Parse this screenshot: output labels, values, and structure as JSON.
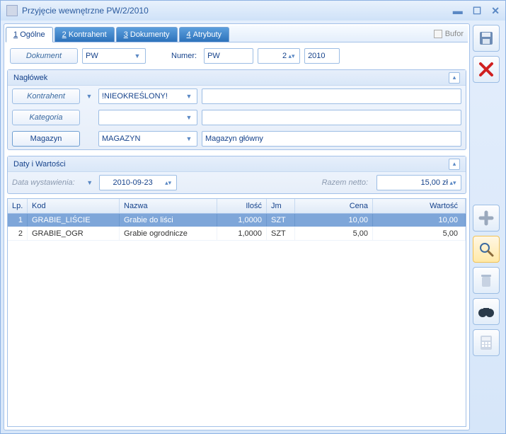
{
  "window": {
    "title": "Przyjęcie wewnętrzne PW/2/2010"
  },
  "tabs": [
    {
      "n": "1",
      "label": "Ogólne"
    },
    {
      "n": "2",
      "label": "Kontrahent"
    },
    {
      "n": "3",
      "label": "Dokumenty"
    },
    {
      "n": "4",
      "label": "Atrybuty"
    }
  ],
  "bufor_label": "Bufor",
  "docrow": {
    "doc_btn": "Dokument",
    "doc_type": "PW",
    "numer_label": "Numer:",
    "numer_prefix": "PW",
    "numer_no": "2",
    "numer_year": "2010"
  },
  "naglowek": {
    "title": "Nagłówek",
    "kontrahent_btn": "Kontrahent",
    "kontrahent_val": "!NIEOKREŚLONY!",
    "kategoria_btn": "Kategoria",
    "magazyn_btn": "Magazyn",
    "magazyn_val": "MAGAZYN",
    "magazyn_desc": "Magazyn główny"
  },
  "daty": {
    "title": "Daty i Wartości",
    "date_label": "Data wystawienia:",
    "date_val": "2010-09-23",
    "net_label": "Razem netto:",
    "net_val": "15,00 zł"
  },
  "grid": {
    "headers": {
      "lp": "Lp.",
      "kod": "Kod",
      "nazwa": "Nazwa",
      "ilosc": "Ilość",
      "jm": "Jm",
      "cena": "Cena",
      "wartosc": "Wartość"
    },
    "rows": [
      {
        "lp": "1",
        "kod": "GRABIE_LIŚCIE",
        "nazwa": "Grabie do liści",
        "ilosc": "1,0000",
        "jm": "SZT",
        "cena": "10,00",
        "wartosc": "10,00",
        "selected": true
      },
      {
        "lp": "2",
        "kod": "GRABIE_OGR",
        "nazwa": "Grabie ogrodnicze",
        "ilosc": "1,0000",
        "jm": "SZT",
        "cena": "5,00",
        "wartosc": "5,00",
        "selected": false
      }
    ]
  }
}
